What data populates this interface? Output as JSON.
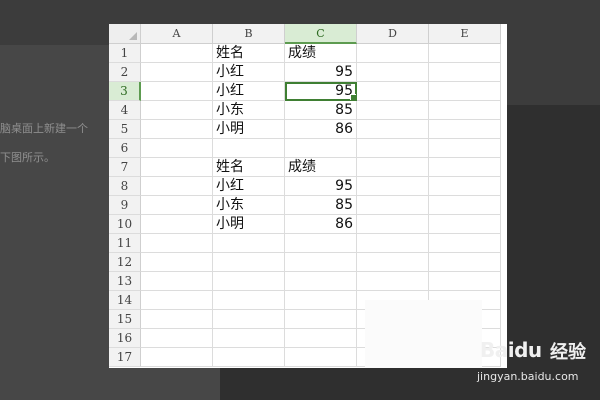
{
  "background_document": {
    "line1": "脑桌面上新建一个",
    "line2": "下图所示。"
  },
  "spreadsheet": {
    "columns": [
      "A",
      "B",
      "C",
      "D",
      "E"
    ],
    "active_column": "C",
    "active_row": 3,
    "rows": [
      {
        "num": "1",
        "cells": [
          "",
          "姓名",
          "成绩",
          "",
          ""
        ]
      },
      {
        "num": "2",
        "cells": [
          "",
          "小红",
          "95",
          "",
          ""
        ]
      },
      {
        "num": "3",
        "cells": [
          "",
          "小红",
          "95",
          "",
          ""
        ]
      },
      {
        "num": "4",
        "cells": [
          "",
          "小东",
          "85",
          "",
          ""
        ]
      },
      {
        "num": "5",
        "cells": [
          "",
          "小明",
          "86",
          "",
          ""
        ]
      },
      {
        "num": "6",
        "cells": [
          "",
          "",
          "",
          "",
          ""
        ]
      },
      {
        "num": "7",
        "cells": [
          "",
          "姓名",
          "成绩",
          "",
          ""
        ]
      },
      {
        "num": "8",
        "cells": [
          "",
          "小红",
          "95",
          "",
          ""
        ]
      },
      {
        "num": "9",
        "cells": [
          "",
          "小东",
          "85",
          "",
          ""
        ]
      },
      {
        "num": "10",
        "cells": [
          "",
          "小明",
          "86",
          "",
          ""
        ]
      },
      {
        "num": "11",
        "cells": [
          "",
          "",
          "",
          "",
          ""
        ]
      },
      {
        "num": "12",
        "cells": [
          "",
          "",
          "",
          "",
          ""
        ]
      },
      {
        "num": "13",
        "cells": [
          "",
          "",
          "",
          "",
          ""
        ]
      },
      {
        "num": "14",
        "cells": [
          "",
          "",
          "",
          "",
          ""
        ]
      },
      {
        "num": "15",
        "cells": [
          "",
          "",
          "",
          "",
          ""
        ]
      },
      {
        "num": "16",
        "cells": [
          "",
          "",
          "",
          "",
          ""
        ]
      },
      {
        "num": "17",
        "cells": [
          "",
          "",
          "",
          "",
          ""
        ]
      }
    ]
  },
  "watermark": {
    "logo": "Baidu",
    "brand": "经验",
    "url": "jingyan.baidu.com"
  },
  "colors": {
    "selection": "#3f7f33",
    "header_active": "#d9ecd4"
  }
}
